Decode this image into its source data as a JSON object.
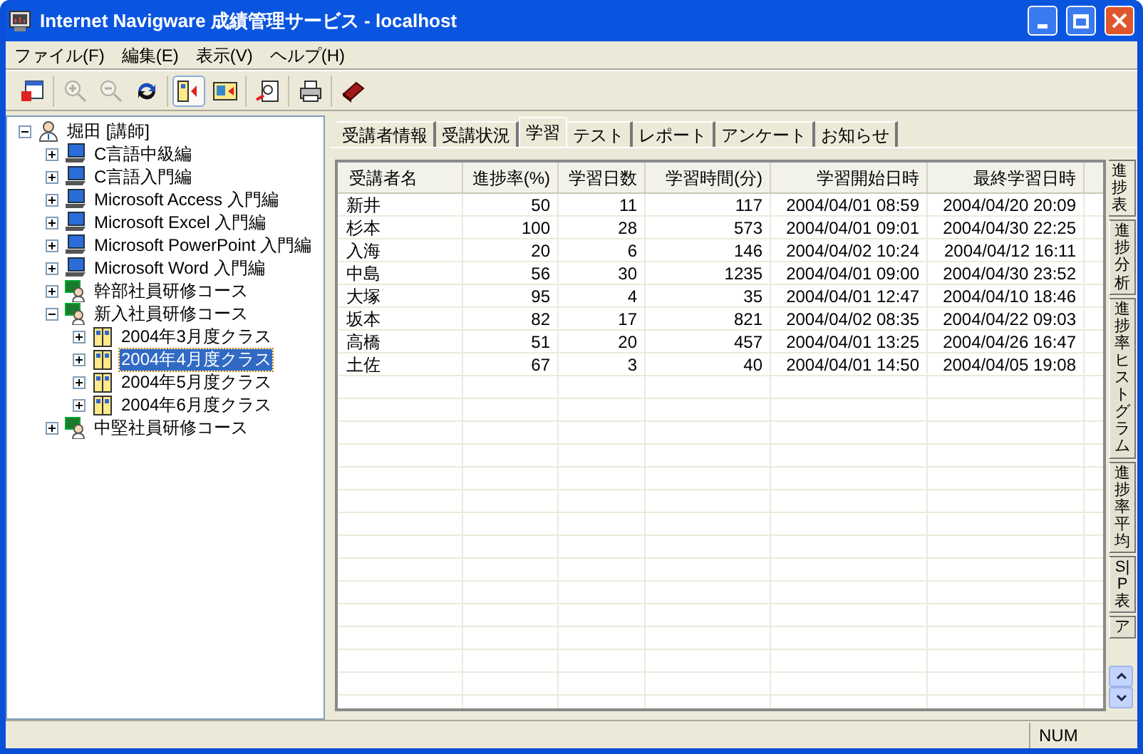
{
  "window": {
    "title": "Internet Navigware 成績管理サービス - localhost"
  },
  "menu": [
    "ファイル(F)",
    "編集(E)",
    "表示(V)",
    "ヘルプ(H)"
  ],
  "toolbar": [
    [
      {
        "kind": "window",
        "disabled": false,
        "pressed": false
      }
    ],
    [
      {
        "kind": "zoom-in",
        "disabled": true,
        "pressed": false
      },
      {
        "kind": "zoom-out",
        "disabled": true,
        "pressed": false
      },
      {
        "kind": "refresh",
        "disabled": false,
        "pressed": false
      }
    ],
    [
      {
        "kind": "layout-a",
        "disabled": false,
        "pressed": true
      },
      {
        "kind": "layout-b",
        "disabled": false,
        "pressed": false
      }
    ],
    [
      {
        "kind": "report",
        "disabled": false,
        "pressed": false
      }
    ],
    [
      {
        "kind": "print",
        "disabled": false,
        "pressed": false
      }
    ],
    [
      {
        "kind": "book",
        "disabled": false,
        "pressed": false
      }
    ]
  ],
  "tree": [
    {
      "label": "堀田 [講師]",
      "kind": "teacher",
      "expanded": true,
      "selected": false,
      "children": [
        {
          "label": "C言語中級編",
          "kind": "course",
          "expanded": false,
          "selected": false
        },
        {
          "label": "C言語入門編",
          "kind": "course",
          "expanded": false,
          "selected": false
        },
        {
          "label": "Microsoft Access 入門編",
          "kind": "course",
          "expanded": false,
          "selected": false
        },
        {
          "label": "Microsoft Excel 入門編",
          "kind": "course",
          "expanded": false,
          "selected": false
        },
        {
          "label": "Microsoft PowerPoint 入門編",
          "kind": "course",
          "expanded": false,
          "selected": false
        },
        {
          "label": "Microsoft Word 入門編",
          "kind": "course",
          "expanded": false,
          "selected": false
        },
        {
          "label": "幹部社員研修コース",
          "kind": "group",
          "expanded": false,
          "selected": false
        },
        {
          "label": "新入社員研修コース",
          "kind": "group",
          "expanded": true,
          "selected": false,
          "children": [
            {
              "label": "2004年3月度クラス",
              "kind": "class",
              "expanded": false,
              "selected": false
            },
            {
              "label": "2004年4月度クラス",
              "kind": "class",
              "expanded": false,
              "selected": true
            },
            {
              "label": "2004年5月度クラス",
              "kind": "class",
              "expanded": false,
              "selected": false
            },
            {
              "label": "2004年6月度クラス",
              "kind": "class",
              "expanded": false,
              "selected": false
            }
          ]
        },
        {
          "label": "中堅社員研修コース",
          "kind": "group",
          "expanded": false,
          "selected": false
        }
      ]
    }
  ],
  "tabs": [
    {
      "label": "受講者情報",
      "selected": false
    },
    {
      "label": "受講状況",
      "selected": false
    },
    {
      "label": "学習",
      "selected": true
    },
    {
      "label": "テスト",
      "selected": false
    },
    {
      "label": "レポート",
      "selected": false
    },
    {
      "label": "アンケート",
      "selected": false
    },
    {
      "label": "お知らせ",
      "selected": false
    }
  ],
  "side_tabs": [
    {
      "label": "進捗表",
      "selected": true
    },
    {
      "label": "進捗分析",
      "selected": false
    },
    {
      "label": "進捗率ヒストグラム",
      "selected": false
    },
    {
      "label": "進捗率平均",
      "selected": false
    },
    {
      "label": "S|P表",
      "selected": false
    },
    {
      "label": "ア",
      "selected": false
    }
  ],
  "table": {
    "columns": [
      "受講者名",
      "進捗率(%)",
      "学習日数",
      "学習時間(分)",
      "学習開始日時",
      "最終学習日時"
    ],
    "rows": [
      [
        "新井",
        "50",
        "11",
        "117",
        "2004/04/01 08:59",
        "2004/04/20 20:09"
      ],
      [
        "杉本",
        "100",
        "28",
        "573",
        "2004/04/01 09:01",
        "2004/04/30 22:25"
      ],
      [
        "入海",
        "20",
        "6",
        "146",
        "2004/04/02 10:24",
        "2004/04/12 16:11"
      ],
      [
        "中島",
        "56",
        "30",
        "1235",
        "2004/04/01 09:00",
        "2004/04/30 23:52"
      ],
      [
        "大塚",
        "95",
        "4",
        "35",
        "2004/04/01 12:47",
        "2004/04/10 18:46"
      ],
      [
        "坂本",
        "82",
        "17",
        "821",
        "2004/04/02 08:35",
        "2004/04/22 09:03"
      ],
      [
        "高橋",
        "51",
        "20",
        "457",
        "2004/04/01 13:25",
        "2004/04/26 16:47"
      ],
      [
        "土佐",
        "67",
        "3",
        "40",
        "2004/04/01 14:50",
        "2004/04/05 19:08"
      ]
    ]
  },
  "status_bar": {
    "indicator": "NUM"
  }
}
